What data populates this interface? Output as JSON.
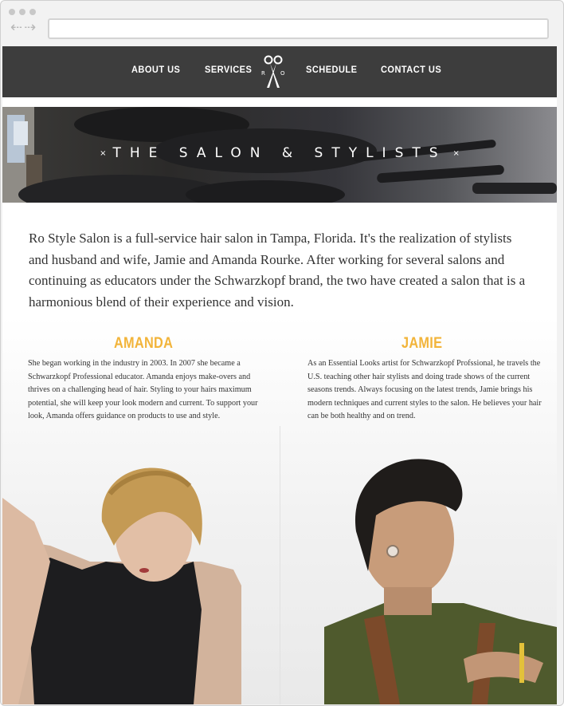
{
  "nav": {
    "about": "ABOUT US",
    "services": "SERVICES",
    "schedule": "SCHEDULE",
    "contact": "CONTACT US",
    "logo_letters": [
      "R",
      "O"
    ]
  },
  "hero": {
    "title": "THE SALON & STYLISTS",
    "ornament": "×"
  },
  "intro": "Ro Style Salon is a full-service hair salon in Tampa, Florida. It's the realization of stylists and husband and wife, Jamie and Amanda Rourke. After working for several salons and continuing as educators under the Schwarzkopf brand, the two have created a salon that is a harmonious blend of their experience and vision.",
  "stylists": [
    {
      "name": "AMANDA",
      "bio": "She began working in the industry in 2003. In 2007 she became a Schwarzkopf Professional educator. Amanda enjoys make-overs and thrives on a challenging head of hair. Styling to your hairs maximum potential, she will keep your look modern and current. To support your look, Amanda offers guidance on products to use and style."
    },
    {
      "name": "JAMIE",
      "bio": "As an Essential Looks artist for Schwarzkopf Profssional, he travels the U.S. teaching other hair stylists and doing trade shows of the current seasons trends. Always focusing on the latest trends, Jamie brings his modern techniques and current styles to the salon. He believes your hair can be both healthy and on trend."
    }
  ],
  "colors": {
    "nav_bg": "#3d3d3d",
    "accent": "#f2b43a",
    "text": "#333333"
  }
}
